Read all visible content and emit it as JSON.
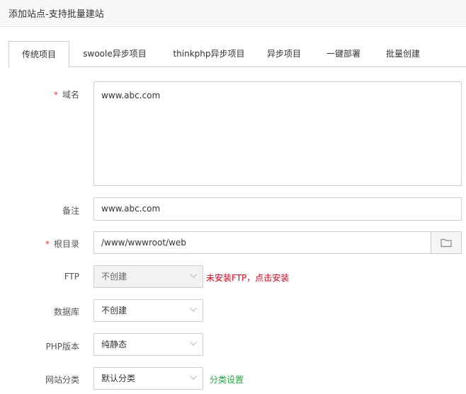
{
  "dialog": {
    "title": "添加站点-支持批量建站"
  },
  "tabs": [
    {
      "label": "传统项目",
      "active": true
    },
    {
      "label": "swoole异步项目"
    },
    {
      "label": "thinkphp异步项目"
    },
    {
      "label": "异步项目"
    },
    {
      "label": "一键部署"
    },
    {
      "label": "批量创建"
    }
  ],
  "form": {
    "domain": {
      "label": "域名",
      "required_mark": "*",
      "value": "www.abc.com"
    },
    "remark": {
      "label": "备注",
      "value": "www.abc.com"
    },
    "root": {
      "label": "根目录",
      "required_mark": "*",
      "value": "/www/wwwroot/web"
    },
    "ftp": {
      "label": "FTP",
      "selected": "不创建",
      "note": "未安装FTP，点击安装"
    },
    "database": {
      "label": "数据库",
      "selected": "不创建"
    },
    "php": {
      "label": "PHP版本",
      "selected": "纯静态"
    },
    "category": {
      "label": "网站分类",
      "selected": "默认分类",
      "link": "分类设置"
    }
  },
  "colors": {
    "required": "#ee3333",
    "warning_link": "#d9001b",
    "success_link": "#20a53a"
  }
}
